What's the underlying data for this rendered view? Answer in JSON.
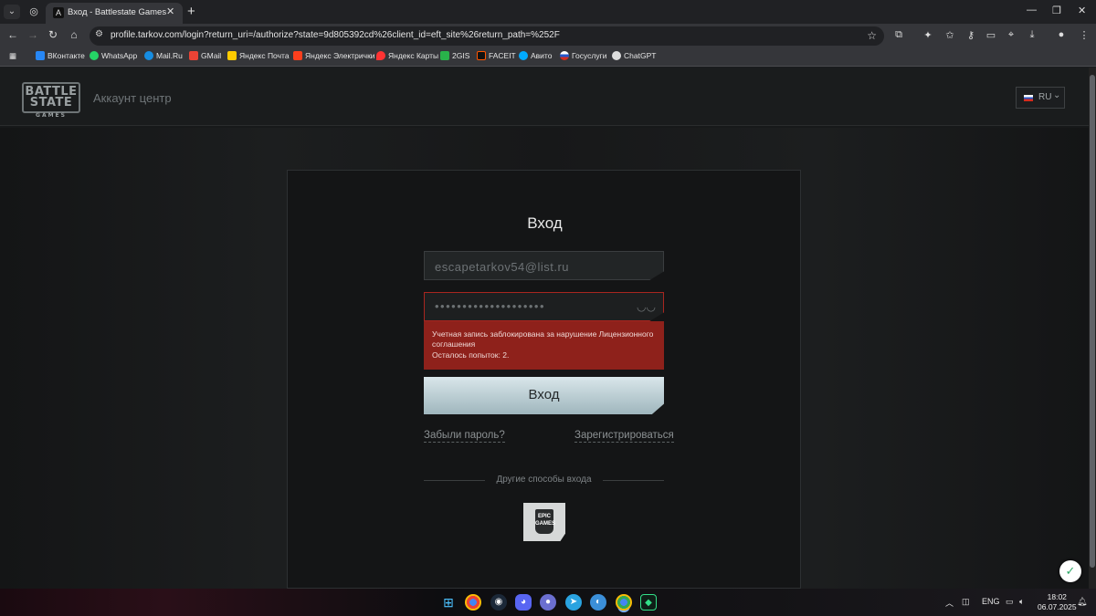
{
  "browser": {
    "pinned_tab_icon": "whatsapp-icon",
    "tab_title": "Вход - Battlestate Games",
    "tab_favicon": "A",
    "url": "profile.tarkov.com/login?return_uri=/authorize?state=9d805392cd%26client_id=eft_site%26return_path=%252F",
    "bookmarks": [
      "ВКонтакте",
      "WhatsApp",
      "Mail.Ru",
      "GMail",
      "Яндекс Почта",
      "Яндекс Электрички",
      "Яндекс Карты",
      "2GIS",
      "FACEIT",
      "Авито",
      "Госуслуги",
      "ChatGPT"
    ]
  },
  "header": {
    "logo_line1": "BATTLE",
    "logo_line2": "STATE",
    "logo_line3": "GAMES",
    "account_center": "Аккаунт центр",
    "language": "RU"
  },
  "login": {
    "title": "Вход",
    "email_value": "escapetarkov54@list.ru",
    "password_value": "••••••••••••••••••••",
    "error_line1": "Учетная запись заблокирована за нарушение Лицензионного",
    "error_line2": "соглашения",
    "error_line3": "Осталось попыток: 2.",
    "submit_label": "Вход",
    "forgot_password": "Забыли пароль?",
    "register": "Зарегистрироваться",
    "other_methods": "Другие способы входа",
    "epic_label": "EPIC GAMES"
  },
  "taskbar": {
    "language": "ENG",
    "time": "18:02",
    "date": "06.07.2025"
  },
  "colors": {
    "error_bg": "#8e211b",
    "error_border": "#a8261f",
    "button_top": "#d9e6ea",
    "button_bottom": "#9fb6bd"
  }
}
